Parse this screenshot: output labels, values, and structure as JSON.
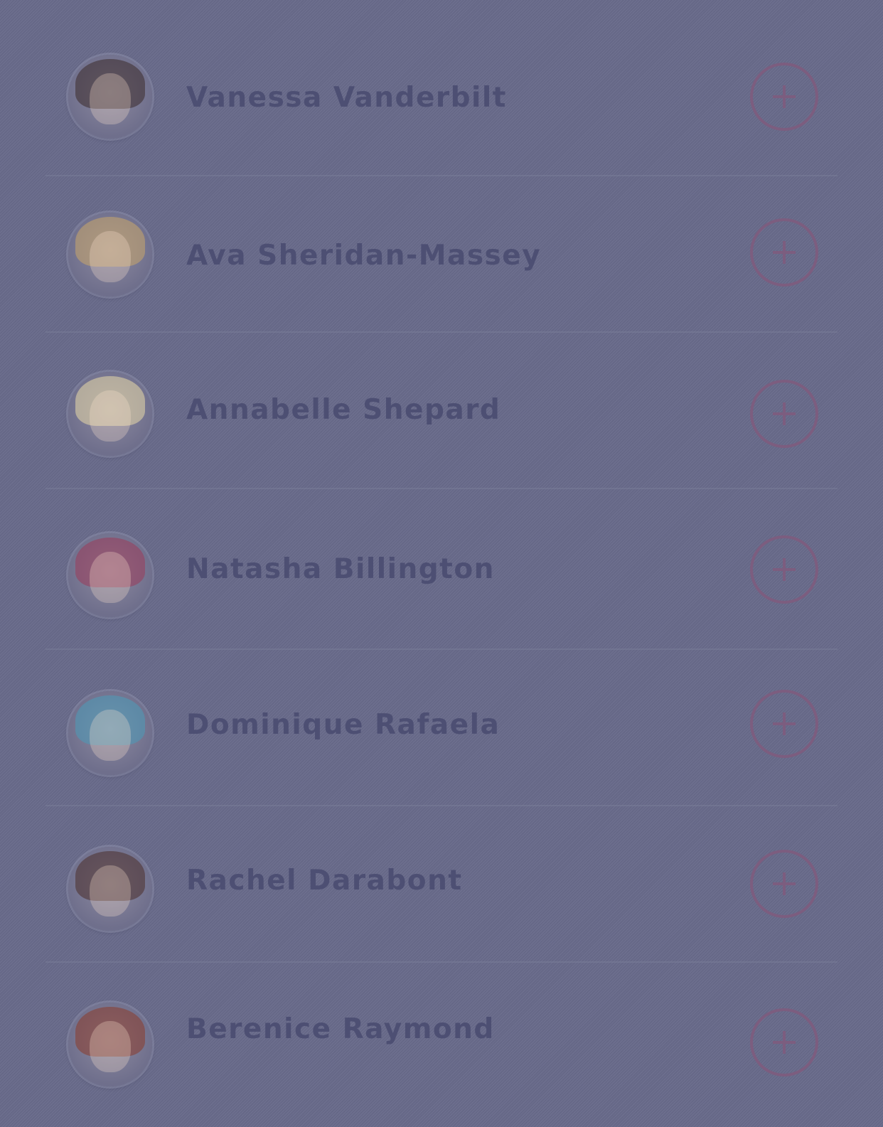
{
  "colors": {
    "background": "#6a6c8c",
    "name_text": "#4d4f73",
    "add_button": "#7c5d7f",
    "divider": "#787b98"
  },
  "contacts": [
    {
      "name": "Vanessa Vanderbilt",
      "avatar_icon": "avatar-photo",
      "action_icon": "plus-icon",
      "hair_color": "#3a2a2a"
    },
    {
      "name": "Ava Sheridan-Massey",
      "avatar_icon": "avatar-photo",
      "action_icon": "plus-icon",
      "hair_color": "#c9a56a"
    },
    {
      "name": "Annabelle Shepard",
      "avatar_icon": "avatar-photo",
      "action_icon": "plus-icon",
      "hair_color": "#e8d8a8"
    },
    {
      "name": "Natasha Billington",
      "avatar_icon": "avatar-photo",
      "action_icon": "plus-icon",
      "hair_color": "#9a3a5a"
    },
    {
      "name": "Dominique Rafaela",
      "avatar_icon": "avatar-photo",
      "action_icon": "plus-icon",
      "hair_color": "#4a9ab8"
    },
    {
      "name": "Rachel Darabont",
      "avatar_icon": "avatar-photo",
      "action_icon": "plus-icon",
      "hair_color": "#4a2e2a"
    },
    {
      "name": "Berenice Raymond",
      "avatar_icon": "avatar-photo",
      "action_icon": "plus-icon",
      "hair_color": "#8a3a2a"
    }
  ]
}
